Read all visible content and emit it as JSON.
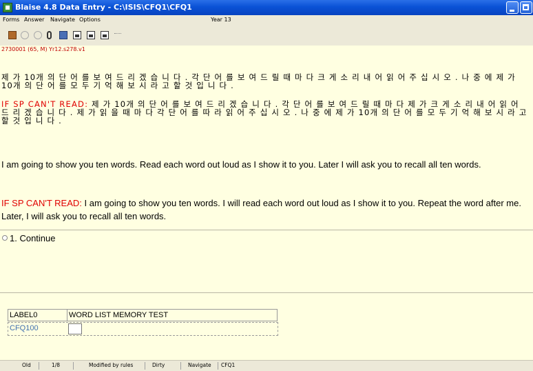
{
  "window": {
    "title": "Blaise 4.8 Data Entry - C:\\ISIS\\CFQ1\\CFQ1"
  },
  "menubar": {
    "items": [
      "Forms",
      "Answer",
      "Navigate",
      "Options"
    ],
    "info": "Year 13"
  },
  "toolbar": {
    "icons": [
      "edit-icon",
      "help-icon",
      "info-icon",
      "attach-icon",
      "book-icon",
      "window-icon",
      "window-icon",
      "window-icon",
      "more-icon"
    ]
  },
  "question": {
    "id": "2730001 (65, M)  Yr12.s278.v1",
    "korean_1": "제 가 10개 의 단 어 를 보 여 드 리 겠 습 니 다 .  각 단 어 를 보 여 드 릴 때 마 다 크 게 소 리 내 어 읽 어 주 십 시 오 . 나 중 에 제 가 10개 의 단 어 를 모 두 기 억 해 보 시 라 고 할 것 입 니 다 .",
    "korean_2_prefix": "IF SP CAN'T READ: ",
    "korean_2": "제 가 10개 의 단 어 를 보 여 드 리 겠 습 니 다 .  각 단 어 를 보 여 드 릴 때 마 다 제 가 크 게 소 리 내 어 읽 어 드 리 겠 습 니 다 .  제 가 읽 을 때 마 다 각 단 어 를 따 라 읽 어 주 십 시 오 . 나 중 에 제 가 10개 의 단 어 를 모 두 기 억 해 보 시 라 고 할 것 입 니 다 .",
    "english_1": "I am going to show you ten words.  Read each word out loud as I show it to you.  Later I will ask you to recall all ten words.",
    "english_2_prefix": "IF SP CAN'T READ: ",
    "english_2": "I am going to show you ten words.  I will read each word out loud as I show it to you.  Repeat the word after me.  Later, I will ask you to recall all ten words."
  },
  "answer": {
    "options": [
      {
        "label": "1. Continue"
      }
    ]
  },
  "form": {
    "label_name": "LABEL0",
    "label_value": "WORD LIST MEMORY TEST",
    "field_name": "CFQ100",
    "field_value": ""
  },
  "status": {
    "items": [
      "Old",
      "1/8",
      "Modified by rules",
      "Dirty",
      "Navigate",
      "CFQ1"
    ]
  },
  "colors": {
    "title_blue": "#0a52d6",
    "question_bg": "#ffffe1",
    "accent_red": "#e00000",
    "field_blue": "#4070b0"
  }
}
